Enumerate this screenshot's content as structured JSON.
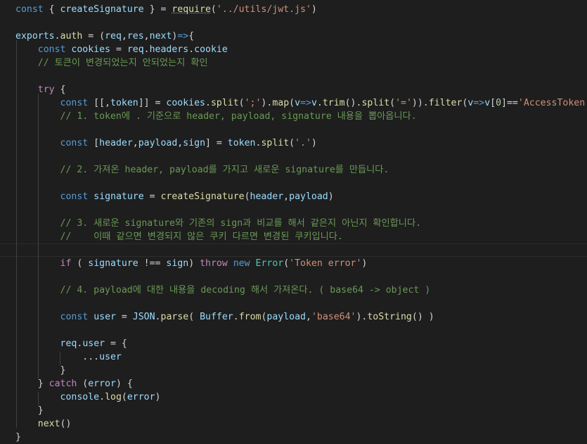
{
  "editor": {
    "colors": {
      "background": "#1e1e1e",
      "keyword": "#569cd6",
      "control": "#c586c0",
      "variable": "#9cdcfe",
      "function": "#dcdcaa",
      "string": "#ce9178",
      "comment": "#6a9955",
      "number": "#b5cea8",
      "type": "#4ec9b0",
      "text": "#d4d4d4"
    },
    "lines": [
      [
        [
          "kw",
          "const"
        ],
        [
          "punc",
          " { "
        ],
        [
          "var",
          "createSignature"
        ],
        [
          "punc",
          " } = "
        ],
        [
          "fn",
          "require"
        ],
        [
          "punc",
          "("
        ],
        [
          "str",
          "'../utils/jwt.js'"
        ],
        [
          "punc",
          ")"
        ]
      ],
      [],
      [
        [
          "var",
          "exports"
        ],
        [
          "punc",
          "."
        ],
        [
          "fn",
          "auth"
        ],
        [
          "punc",
          " = ("
        ],
        [
          "var",
          "req"
        ],
        [
          "punc",
          ","
        ],
        [
          "var",
          "res"
        ],
        [
          "punc",
          ","
        ],
        [
          "var",
          "next"
        ],
        [
          "punc",
          ")"
        ],
        [
          "kw",
          "=>"
        ],
        [
          "punc",
          "{"
        ]
      ],
      [
        [
          "punc",
          "    "
        ],
        [
          "kw",
          "const"
        ],
        [
          "punc",
          " "
        ],
        [
          "var",
          "cookies"
        ],
        [
          "punc",
          " = "
        ],
        [
          "var",
          "req"
        ],
        [
          "punc",
          "."
        ],
        [
          "var",
          "headers"
        ],
        [
          "punc",
          "."
        ],
        [
          "var",
          "cookie"
        ]
      ],
      [
        [
          "punc",
          "    "
        ],
        [
          "cmt",
          "// 토큰이 변경되었는지 안되었는지 확인"
        ]
      ],
      [],
      [
        [
          "punc",
          "    "
        ],
        [
          "ctrl",
          "try"
        ],
        [
          "punc",
          " {"
        ]
      ],
      [
        [
          "punc",
          "        "
        ],
        [
          "kw",
          "const"
        ],
        [
          "punc",
          " [[,"
        ],
        [
          "var",
          "token"
        ],
        [
          "punc",
          "]] = "
        ],
        [
          "var",
          "cookies"
        ],
        [
          "punc",
          "."
        ],
        [
          "fn",
          "split"
        ],
        [
          "punc",
          "("
        ],
        [
          "str",
          "';'"
        ],
        [
          "punc",
          ")."
        ],
        [
          "fn",
          "map"
        ],
        [
          "punc",
          "("
        ],
        [
          "var",
          "v"
        ],
        [
          "kw",
          "=>"
        ],
        [
          "var",
          "v"
        ],
        [
          "punc",
          "."
        ],
        [
          "fn",
          "trim"
        ],
        [
          "punc",
          "()."
        ],
        [
          "fn",
          "split"
        ],
        [
          "punc",
          "("
        ],
        [
          "str",
          "'='"
        ],
        [
          "punc",
          "))."
        ],
        [
          "fn",
          "filter"
        ],
        [
          "punc",
          "("
        ],
        [
          "var",
          "v"
        ],
        [
          "kw",
          "=>"
        ],
        [
          "var",
          "v"
        ],
        [
          "punc",
          "["
        ],
        [
          "num",
          "0"
        ],
        [
          "punc",
          "]=="
        ],
        [
          "str",
          "'AccessToken'"
        ],
        [
          "punc",
          ")"
        ]
      ],
      [
        [
          "punc",
          "        "
        ],
        [
          "cmt",
          "// 1. token에 . 기준으로 header, payload, signature 내용을 뽑아옵니다."
        ]
      ],
      [],
      [
        [
          "punc",
          "        "
        ],
        [
          "kw",
          "const"
        ],
        [
          "punc",
          " ["
        ],
        [
          "var",
          "header"
        ],
        [
          "punc",
          ","
        ],
        [
          "var",
          "payload"
        ],
        [
          "punc",
          ","
        ],
        [
          "var",
          "sign"
        ],
        [
          "punc",
          "] = "
        ],
        [
          "var",
          "token"
        ],
        [
          "punc",
          "."
        ],
        [
          "fn",
          "split"
        ],
        [
          "punc",
          "("
        ],
        [
          "str",
          "'.'"
        ],
        [
          "punc",
          ")"
        ]
      ],
      [],
      [
        [
          "punc",
          "        "
        ],
        [
          "cmt",
          "// 2. 가져온 header, payload를 가지고 새로운 signature를 만듭니다."
        ]
      ],
      [],
      [
        [
          "punc",
          "        "
        ],
        [
          "kw",
          "const"
        ],
        [
          "punc",
          " "
        ],
        [
          "var",
          "signature"
        ],
        [
          "punc",
          " = "
        ],
        [
          "fn",
          "createSignature"
        ],
        [
          "punc",
          "("
        ],
        [
          "var",
          "header"
        ],
        [
          "punc",
          ","
        ],
        [
          "var",
          "payload"
        ],
        [
          "punc",
          ")"
        ]
      ],
      [],
      [
        [
          "punc",
          "        "
        ],
        [
          "cmt",
          "// 3. 새로운 signature와 기존의 sign과 비교를 해서 같은지 아닌지 확인합니다."
        ]
      ],
      [
        [
          "punc",
          "        "
        ],
        [
          "cmt",
          "//    이때 같으면 변경되지 않은 쿠키 다르면 변경된 쿠키입니다."
        ]
      ],
      [],
      [
        [
          "punc",
          "        "
        ],
        [
          "ctrl",
          "if"
        ],
        [
          "punc",
          " ( "
        ],
        [
          "var",
          "signature"
        ],
        [
          "punc",
          " !== "
        ],
        [
          "var",
          "sign"
        ],
        [
          "punc",
          ") "
        ],
        [
          "ctrl",
          "throw"
        ],
        [
          "punc",
          " "
        ],
        [
          "kw",
          "new"
        ],
        [
          "punc",
          " "
        ],
        [
          "type",
          "Error"
        ],
        [
          "punc",
          "("
        ],
        [
          "str",
          "'Token error'"
        ],
        [
          "punc",
          ")"
        ]
      ],
      [],
      [
        [
          "punc",
          "        "
        ],
        [
          "cmt",
          "// 4. payload에 대한 내용을 decoding 해서 가져온다. ( base64 -> object )"
        ]
      ],
      [],
      [
        [
          "punc",
          "        "
        ],
        [
          "kw",
          "const"
        ],
        [
          "punc",
          " "
        ],
        [
          "var",
          "user"
        ],
        [
          "punc",
          " = "
        ],
        [
          "var",
          "JSON"
        ],
        [
          "punc",
          "."
        ],
        [
          "fn",
          "parse"
        ],
        [
          "punc",
          "( "
        ],
        [
          "var",
          "Buffer"
        ],
        [
          "punc",
          "."
        ],
        [
          "fn",
          "from"
        ],
        [
          "punc",
          "("
        ],
        [
          "var",
          "payload"
        ],
        [
          "punc",
          ","
        ],
        [
          "str",
          "'base64'"
        ],
        [
          "punc",
          ")."
        ],
        [
          "fn",
          "toString"
        ],
        [
          "punc",
          "() )"
        ]
      ],
      [],
      [
        [
          "punc",
          "        "
        ],
        [
          "var",
          "req"
        ],
        [
          "punc",
          "."
        ],
        [
          "var",
          "user"
        ],
        [
          "punc",
          " = {"
        ]
      ],
      [
        [
          "punc",
          "            ..."
        ],
        [
          "var",
          "user"
        ]
      ],
      [
        [
          "punc",
          "        }"
        ]
      ],
      [
        [
          "punc",
          "    } "
        ],
        [
          "ctrl",
          "catch"
        ],
        [
          "punc",
          " ("
        ],
        [
          "var",
          "error"
        ],
        [
          "punc",
          ") {"
        ]
      ],
      [
        [
          "punc",
          "        "
        ],
        [
          "var",
          "console"
        ],
        [
          "punc",
          "."
        ],
        [
          "fn",
          "log"
        ],
        [
          "punc",
          "("
        ],
        [
          "var",
          "error"
        ],
        [
          "punc",
          ")"
        ]
      ],
      [
        [
          "punc",
          "    }"
        ]
      ],
      [
        [
          "punc",
          "    "
        ],
        [
          "fn",
          "next"
        ],
        [
          "punc",
          "()"
        ]
      ],
      [
        [
          "punc",
          "}"
        ]
      ]
    ],
    "current_line": 18
  }
}
